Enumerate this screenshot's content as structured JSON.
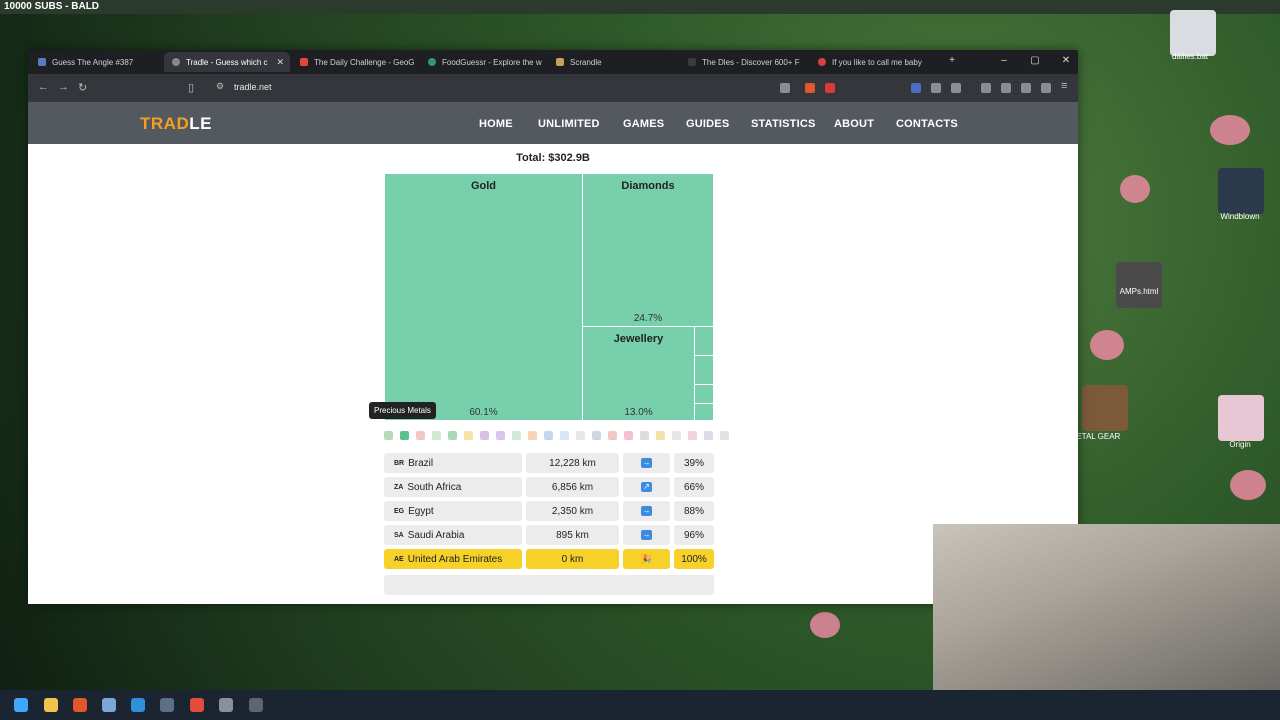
{
  "overlay": {
    "subs_text": "10000 SUBS - BALD"
  },
  "desktop": {
    "icons": [
      {
        "label": "dailies.bat"
      },
      {
        "label": "Windblown"
      },
      {
        "label": "AMPs.html"
      },
      {
        "label": "Origin"
      },
      {
        "label": "METAL GEAR"
      }
    ]
  },
  "browser": {
    "tabs": [
      {
        "label": "Guess The Angle #387",
        "color": "#5a7dbf"
      },
      {
        "label": "Tradle - Guess which c",
        "color": "#888888",
        "active": true
      },
      {
        "label": "The Daily Challenge - GeoG",
        "color": "#e0473b"
      },
      {
        "label": "FoodGuessr - Explore the w",
        "color": "#2e9a6a"
      },
      {
        "label": "Scrandle",
        "color": "#c9a25a"
      },
      {
        "label": "The Dles - Discover 600+ F",
        "color": "#3a3a3a"
      },
      {
        "label": "If you like to call me baby",
        "color": "#d3443c"
      }
    ],
    "url": "tradle.net"
  },
  "site": {
    "logo_part1": "TRAD",
    "logo_part2": "LE",
    "nav": [
      "HOME",
      "UNLIMITED",
      "GAMES",
      "GUIDES",
      "STATISTICS",
      "ABOUT",
      "CONTACTS"
    ]
  },
  "treemap": {
    "total": "Total: $302.9B",
    "cells": [
      {
        "label": "Gold",
        "pct": "60.1%"
      },
      {
        "label": "Diamonds",
        "pct": "24.7%"
      },
      {
        "label": "Jewellery",
        "pct": "13.0%"
      }
    ],
    "tooltip": "Precious Metals"
  },
  "category_dots": [
    "#b7dcb9",
    "#5fc08f",
    "#f4c6c6",
    "#cfe9cf",
    "#a5d9b9",
    "#f5e3a8",
    "#d9c3e3",
    "#d7c6ef",
    "#cfe8d7",
    "#f7d4b2",
    "#c5d6f0",
    "#d7e6f6",
    "#e6e6e6",
    "#cfd6de",
    "#f3c7c7",
    "#f4c0cf",
    "#dcdcdc",
    "#f1e2a9",
    "#e5e5e5",
    "#f3d1d6",
    "#d8dde6",
    "#e2e2e2"
  ],
  "guesses": [
    {
      "code": "BR",
      "country": "Brazil",
      "distance": "12,228 km",
      "direction": "→",
      "percent": "39%",
      "win": false
    },
    {
      "code": "ZA",
      "country": "South Africa",
      "distance": "6,856 km",
      "direction": "↗",
      "percent": "66%",
      "win": false
    },
    {
      "code": "EG",
      "country": "Egypt",
      "distance": "2,350 km",
      "direction": "→",
      "percent": "88%",
      "win": false
    },
    {
      "code": "SA",
      "country": "Saudi Arabia",
      "distance": "895 km",
      "direction": "→",
      "percent": "96%",
      "win": false
    },
    {
      "code": "AE",
      "country": "United Arab Emirates",
      "distance": "0 km",
      "direction": "🎉",
      "percent": "100%",
      "win": true
    }
  ]
}
